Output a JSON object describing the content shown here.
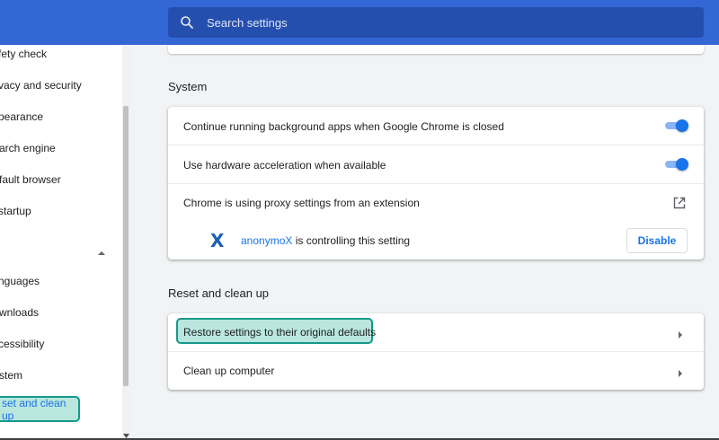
{
  "header": {
    "search": {
      "placeholder": "Search settings",
      "icon": "search-icon"
    },
    "colors": {
      "header_bg": "#3367d6",
      "search_bg": "#254fae"
    }
  },
  "sidebar": {
    "items": [
      {
        "label": "fety check"
      },
      {
        "label": "vacy and security"
      },
      {
        "label": "pearance"
      },
      {
        "label": "arch engine"
      },
      {
        "label": "fault browser"
      },
      {
        "label": " startup"
      },
      {
        "label": "nguages"
      },
      {
        "label": "wnloads"
      },
      {
        "label": "cessibility"
      },
      {
        "label": "stem"
      },
      {
        "label": "set and clean up",
        "selected": true
      }
    ],
    "advanced_expanded_icon": "chevron-up-icon"
  },
  "main": {
    "system": {
      "title": "System",
      "rows": [
        {
          "label": "Continue running background apps when Google Chrome is closed",
          "toggle": true
        },
        {
          "label": "Use hardware acceleration when available",
          "toggle": true
        },
        {
          "label": "Chrome is using proxy settings from an extension",
          "icon": "open-in-new-icon"
        }
      ],
      "extension": {
        "name": "anonymoX",
        "message": " is controlling this setting",
        "button": "Disable",
        "icon_glyph": "X"
      }
    },
    "reset": {
      "title": "Reset and clean up",
      "rows": [
        {
          "label": "Restore settings to their original defaults",
          "highlighted": true
        },
        {
          "label": "Clean up computer"
        }
      ]
    }
  },
  "colors": {
    "accent": "#1a73e8",
    "highlight_border": "#14998a",
    "highlight_fill": "#b9e6dd"
  }
}
